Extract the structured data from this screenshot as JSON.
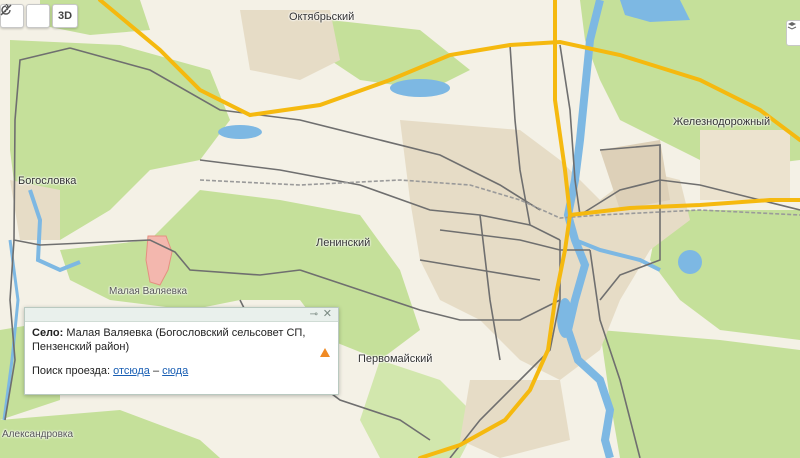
{
  "map": {
    "labels": {
      "oktyabrsky": "Октябрьский",
      "zheleznodorozhny": "Железнодорожный",
      "bogoslovka": "Богословка",
      "leninsky": "Ленинский",
      "malaya_valyaevka": "Малая Валяевка",
      "pervomaisky": "Первомайский",
      "aleksandrovka": "Александровка"
    },
    "colors": {
      "land": "#f4f1e6",
      "forest": "#c5e09a",
      "water": "#7db8e3",
      "urban": "#e6dcc6",
      "major_road": "#f5b90f",
      "road": "#6f6f6f",
      "village": "#f3b7ae"
    }
  },
  "controls": {
    "ruler_icon": "ruler-icon",
    "refresh_icon": "loop-icon",
    "mode_3d": "3D",
    "layers_icon": "layers-icon"
  },
  "popup": {
    "type_label": "Село:",
    "name": "Малая Валяевка (Богословский сельсовет СП,",
    "region": "Пензенский район)",
    "route_label": "Поиск проезда:",
    "from_link": "отсюда",
    "separator": "–",
    "to_link": "сюда",
    "warn_icon": "warning-icon",
    "pin_icon": "pin-icon",
    "close_icon": "close-icon"
  }
}
